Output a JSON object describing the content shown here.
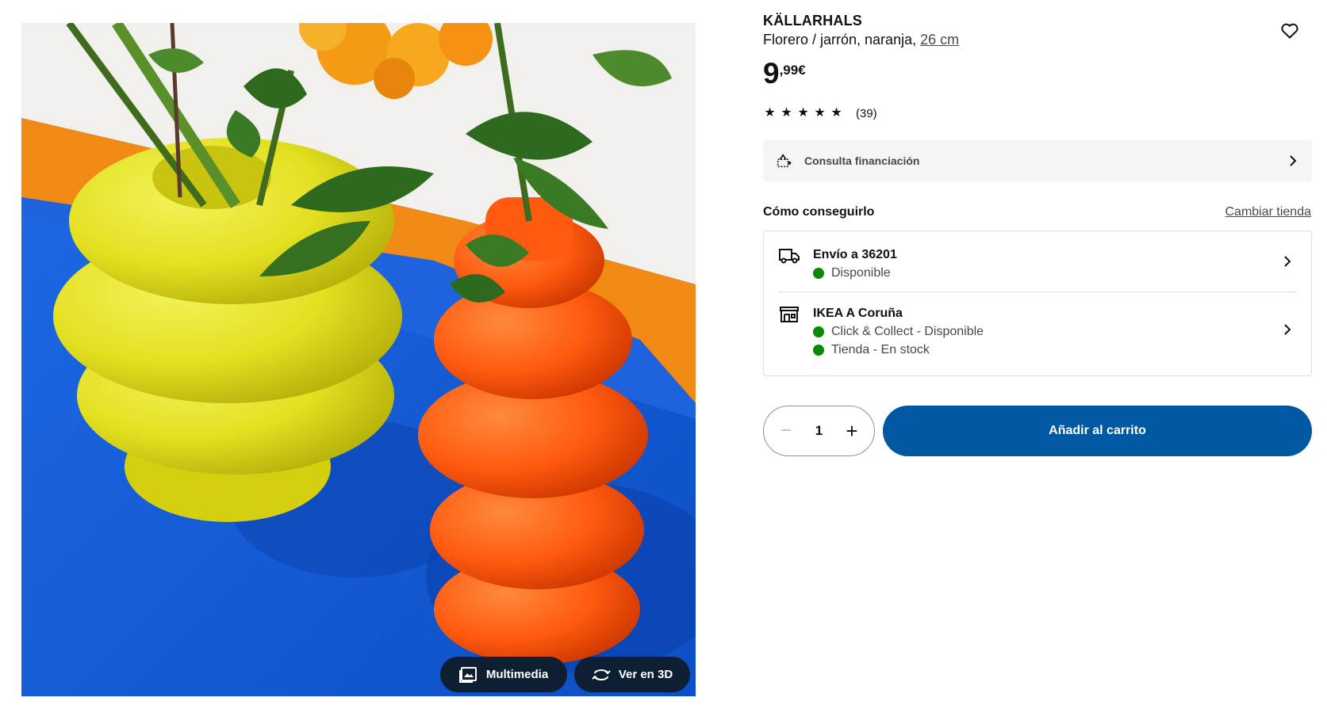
{
  "product": {
    "name": "KÄLLARHALS",
    "description": "Florero / jarrón, naranja, ",
    "size_link": "26 cm",
    "image_alt": "Jarrones amarillo y naranja con flores",
    "favorite_icon": "heart-outline-icon"
  },
  "price": {
    "integer": "9",
    "decimal": ",99€"
  },
  "rating": {
    "stars": 5,
    "count": "(39)"
  },
  "financing": {
    "label": "Consulta financiación",
    "icon": "financing-icon"
  },
  "availability": {
    "title": "Cómo conseguirlo",
    "change_store": "Cambiar tienda",
    "shipping": {
      "title": "Envío a 36201",
      "status": "Disponible",
      "status_color": "#0a8a00",
      "icon": "truck-icon"
    },
    "store": {
      "title": "IKEA A Coruña",
      "statuses": [
        "Click & Collect - Disponible",
        "Tienda - En stock"
      ],
      "icon": "store-icon"
    }
  },
  "quantity": {
    "value": "1",
    "minus": "−",
    "plus": "+"
  },
  "cart": {
    "label": "Añadir al carrito",
    "color": "#0058a3"
  },
  "media": {
    "multimedia_label": "Multimedia",
    "view3d_label": "Ver en 3D"
  }
}
